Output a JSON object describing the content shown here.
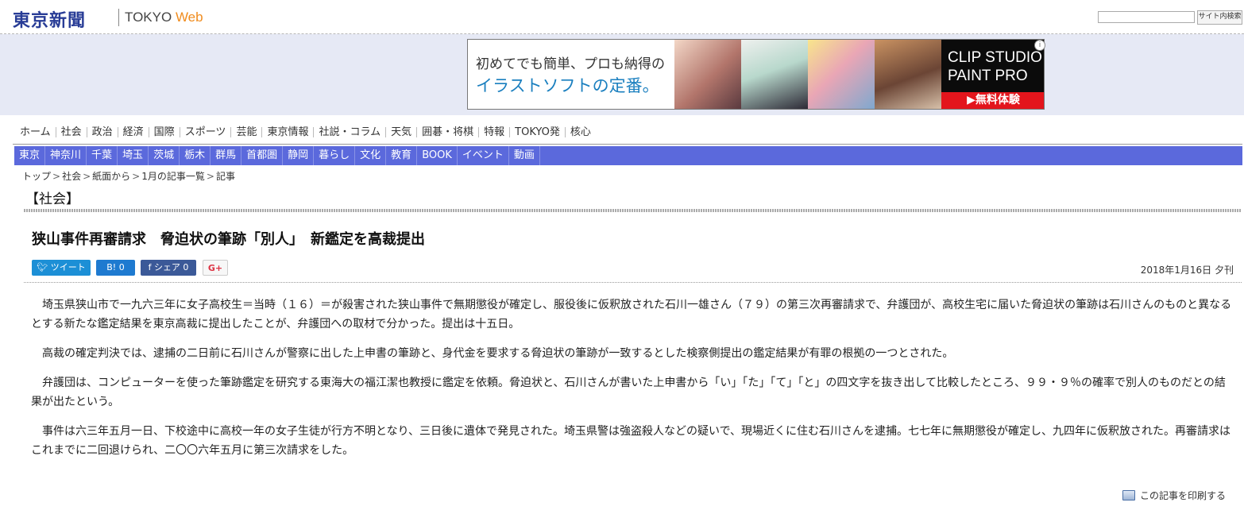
{
  "header": {
    "logo_text": "東京新聞",
    "logo_sub": "TOKYO",
    "logo_sub_accent": "Web",
    "search_placeholder": "",
    "search_button": "サイト内検索"
  },
  "ad": {
    "copy_line1": "初めてでも簡単、プロも納得の",
    "copy_line2": "イラストソフトの定番。",
    "brand_line1": "CLIP STUDIO",
    "brand_line2": "PAINT PRO",
    "cta": "▶無料体験",
    "info": "i"
  },
  "nav_primary": [
    "ホーム",
    "社会",
    "政治",
    "経済",
    "国際",
    "スポーツ",
    "芸能",
    "東京情報",
    "社説・コラム",
    "天気",
    "囲碁・将棋",
    "特報",
    "TOKYO発",
    "核心"
  ],
  "nav_regional": [
    "東京",
    "神奈川",
    "千葉",
    "埼玉",
    "茨城",
    "栃木",
    "群馬",
    "首都圏",
    "静岡",
    "暮らし",
    "文化",
    "教育",
    "BOOK",
    "イベント",
    "動画"
  ],
  "breadcrumb": [
    "トップ",
    "社会",
    "紙面から",
    "1月の記事一覧",
    "記事"
  ],
  "section_title": "【社会】",
  "article": {
    "headline": "狭山事件再審請求　脅迫状の筆跡「別人」　新鑑定を高裁提出",
    "date": "2018年1月16日 夕刊",
    "paragraphs": [
      "埼玉県狭山市で一九六三年に女子高校生＝当時（１６）＝が殺害された狭山事件で無期懲役が確定し、服役後に仮釈放された石川一雄さん（７９）の第三次再審請求で、弁護団が、高校生宅に届いた脅迫状の筆跡は石川さんのものと異なるとする新たな鑑定結果を東京高裁に提出したことが、弁護団への取材で分かった。提出は十五日。",
      "高裁の確定判決では、逮捕の二日前に石川さんが警察に出した上申書の筆跡と、身代金を要求する脅迫状の筆跡が一致するとした検察側提出の鑑定結果が有罪の根拠の一つとされた。",
      "弁護団は、コンピューターを使った筆跡鑑定を研究する東海大の福江潔也教授に鑑定を依頼。脅迫状と、石川さんが書いた上申書から「い」「た」「て」「と」の四文字を抜き出して比較したところ、９９・９％の確率で別人のものだとの結果が出たという。",
      "事件は六三年五月一日、下校途中に高校一年の女子生徒が行方不明となり、三日後に遺体で発見された。埼玉県警は強盗殺人などの疑いで、現場近くに住む石川さんを逮捕。七七年に無期懲役が確定し、九四年に仮釈放された。再審請求はこれまでに二回退けられ、二〇〇六年五月に第三次請求をした。"
    ]
  },
  "share": {
    "tweet": "ツイート",
    "hatena": "B! 0",
    "facebook": "シェア 0",
    "gplus": "G+"
  },
  "print_label": "この記事を印刷する"
}
